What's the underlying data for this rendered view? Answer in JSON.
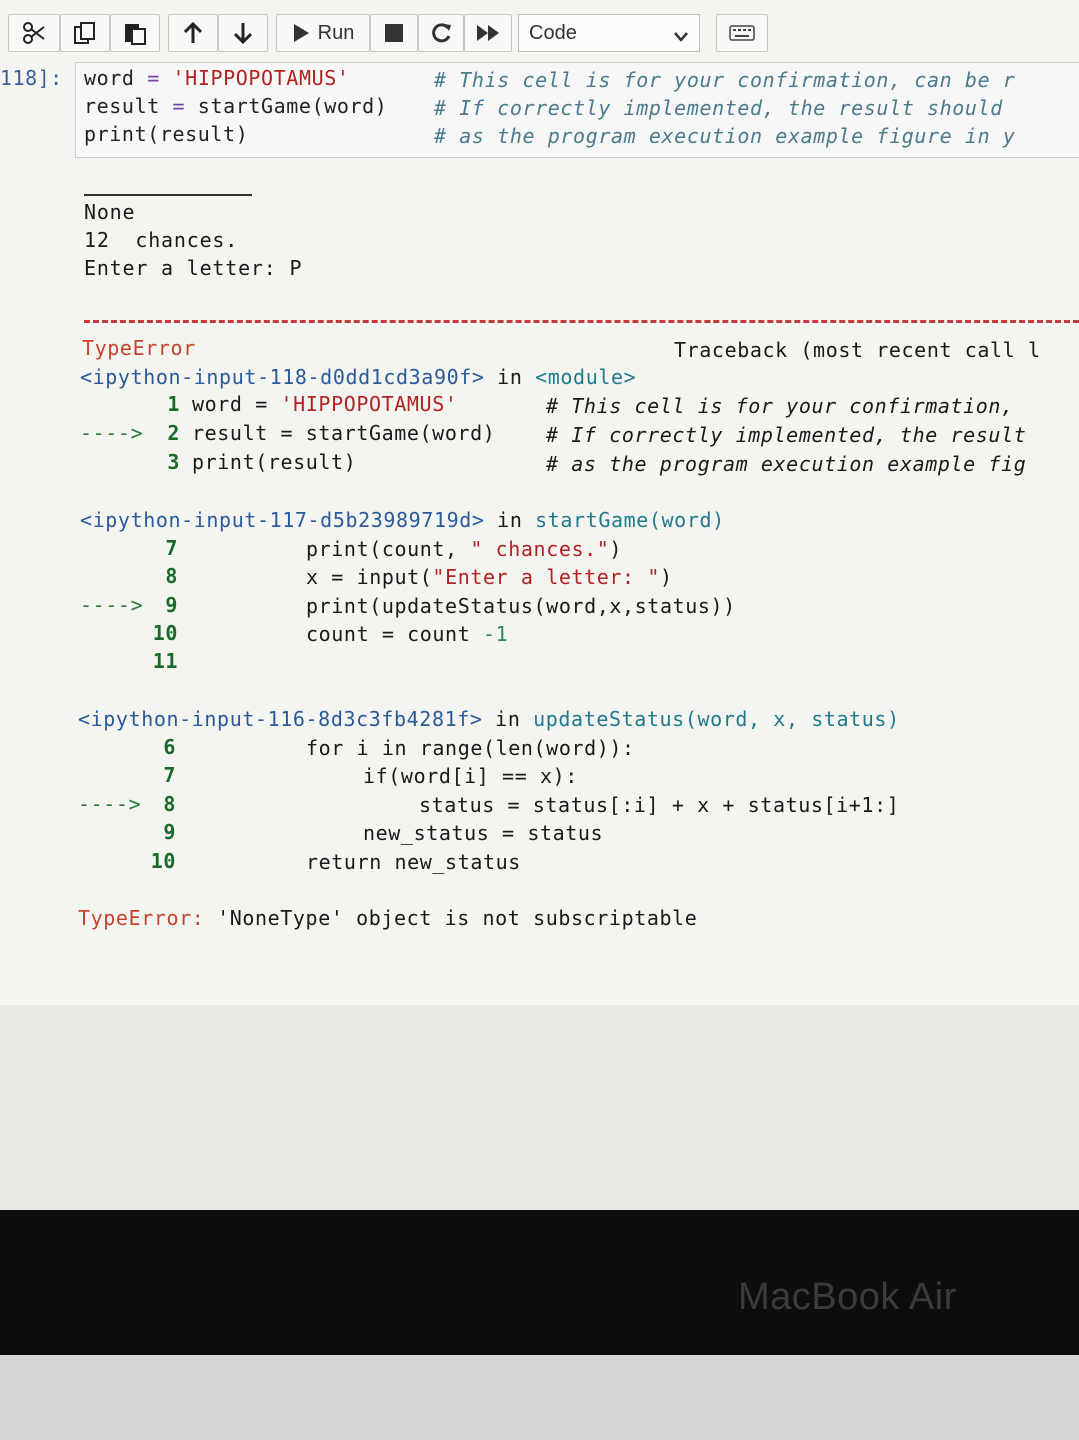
{
  "toolbar": {
    "run_label": "Run",
    "cell_type": "Code",
    "icons": [
      "scissors-icon",
      "copy-icon",
      "paste-icon",
      "arrow-up-icon",
      "arrow-down-icon",
      "play-icon",
      "stop-icon",
      "restart-icon",
      "fast-forward-icon",
      "keyboard-icon"
    ]
  },
  "cell": {
    "prompt": "118]:",
    "lines": [
      {
        "code_a": "word ",
        "op": "=",
        "code_b": " ",
        "str": "'HIPPOPOTAMUS'",
        "comment": "# This cell is for your confirmation, can be r"
      },
      {
        "code_a": "result ",
        "op": "=",
        "code_b": " startGame(word) ",
        "comment": "# If correctly implemented, the result should"
      },
      {
        "code_a": "print(result)",
        "comment": "# as the program execution example figure in y"
      }
    ]
  },
  "output": {
    "line1": "None",
    "line2": "12  chances.",
    "line3": "Enter a letter: P"
  },
  "traceback": {
    "error_name": "TypeError",
    "header_right": "Traceback (most recent call l",
    "frame1": {
      "location": "<ipython-input-118-d0dd1cd3a90f>",
      "in": "in",
      "scope": "<module>",
      "rows": [
        {
          "arrow": "",
          "num": "1",
          "code": "word = ",
          "str": "'HIPPOPOTAMUS'",
          "comment": "# This cell is for your confirmation,"
        },
        {
          "arrow": "---->",
          "num": "2",
          "code": "result = startGame(word) ",
          "comment": "# If correctly implemented, the result"
        },
        {
          "arrow": "",
          "num": "3",
          "code": "print(result)",
          "comment": "# as the program execution example fig"
        }
      ]
    },
    "frame2": {
      "location": "<ipython-input-117-d5b23989719d>",
      "in": "in",
      "scope": "startGame(word)",
      "rows": [
        {
          "arrow": "",
          "num": "7",
          "code_a": "print(count, ",
          "str": "\" chances.\"",
          "code_b": ")"
        },
        {
          "arrow": "",
          "num": "8",
          "code_a": "x = input(",
          "str": "\"Enter a letter: \"",
          "code_b": ")"
        },
        {
          "arrow": "---->",
          "num": "9",
          "code_a": "print(updateStatus(word,x,status))"
        },
        {
          "arrow": "",
          "num": "10",
          "code_a": "count = count ",
          "str": "-1"
        },
        {
          "arrow": "",
          "num": "11",
          "code_a": ""
        }
      ]
    },
    "frame3": {
      "location": "<ipython-input-116-8d3c3fb4281f>",
      "in": "in",
      "scope": "updateStatus(word, x, status)",
      "rows": [
        {
          "arrow": "",
          "num": "6",
          "code_a": "for i in range(len(word)):"
        },
        {
          "arrow": "",
          "num": "7",
          "code_a": "if(word[i] == x):"
        },
        {
          "arrow": "---->",
          "num": "8",
          "code_a": "status = status[:i] + x + status[i+1:]"
        },
        {
          "arrow": "",
          "num": "9",
          "code_a": "new_status = status"
        },
        {
          "arrow": "",
          "num": "10",
          "code_a": "return new_status"
        }
      ]
    },
    "final_error_name": "TypeError:",
    "final_error_msg": " 'NoneType' object is not subscriptable"
  },
  "device": {
    "brand": "MacBook Air"
  }
}
